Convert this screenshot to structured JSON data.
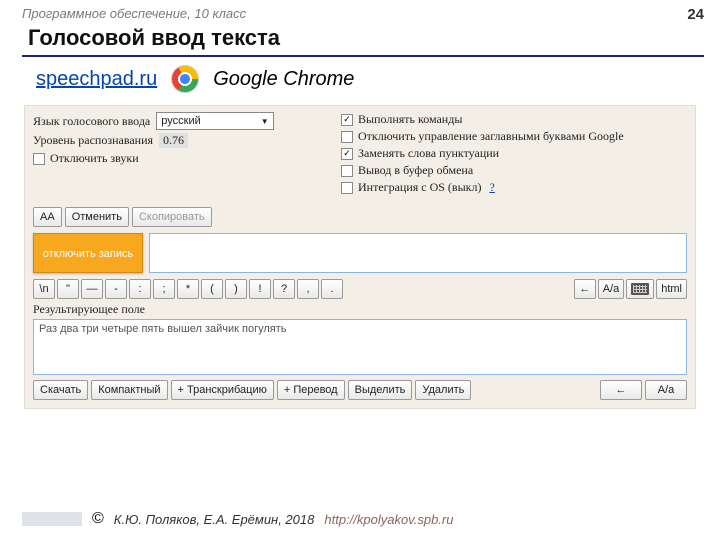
{
  "header": {
    "course": "Программное обеспечение, 10 класс",
    "page_number": "24"
  },
  "title": "Голосовой ввод текста",
  "link": {
    "url_text": "speechpad.ru",
    "browser": "Google Chrome"
  },
  "app": {
    "lang_label": "Язык голосового ввода",
    "lang_value": "русский",
    "rec_label": "Уровень распознавания",
    "rec_value": "0.76",
    "mute_label": "Отключить звуки",
    "options": {
      "cmd": "Выполнять команды",
      "caps": "Отключить управление заглавными буквами Google",
      "punct": "Заменять слова пунктуации",
      "clip": "Вывод в буфер обмена",
      "os": "Интеграция с OS (выкл)"
    },
    "buttons": {
      "aa": "AA",
      "undo": "Отменить",
      "copy": "Скопировать",
      "record": "отключить запись",
      "download": "Скачать",
      "compact": "Компактный",
      "transcribe": "+ Транскрибацию",
      "translate": "+ Перевод",
      "select": "Выделить",
      "delete": "Удалить",
      "back": "←",
      "case": "A/a",
      "html": "html"
    },
    "symbols": [
      "\\n",
      "\"",
      "—",
      "-",
      ":",
      ";",
      "*",
      "(",
      ")",
      "!",
      "?",
      ",",
      "."
    ],
    "result_label": "Результирующее поле",
    "result_text": "Раз два три четыре пять вышел зайчик погулять"
  },
  "footer": {
    "copyright": "К.Ю. Поляков, Е.А. Ерёмин, 2018",
    "url": "http://kpolyakov.spb.ru"
  }
}
